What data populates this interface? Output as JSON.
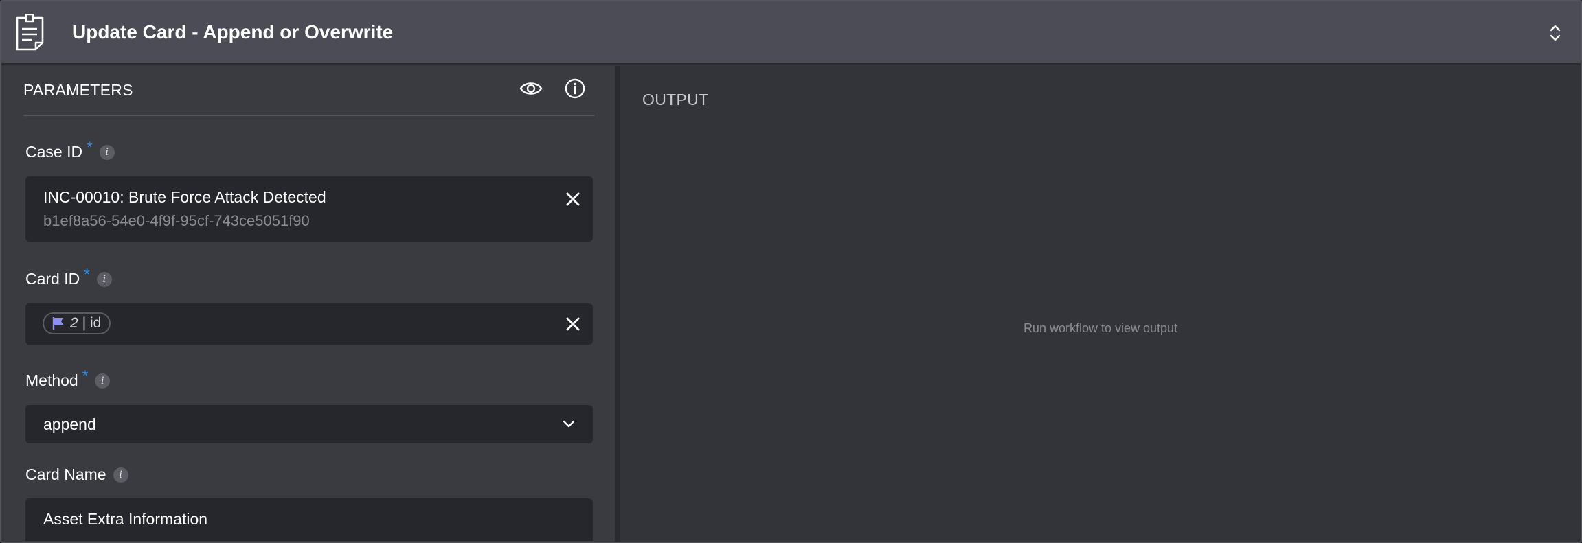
{
  "header": {
    "title": "Update Card - Append or Overwrite",
    "icon": "note-card-icon"
  },
  "parameters": {
    "title": "PARAMETERS",
    "fields": {
      "case_id": {
        "label": "Case ID",
        "required_mark": "*",
        "info_glyph": "i",
        "value_title": "INC-00010: Brute Force Attack Detected",
        "value_subtitle": "b1ef8a56-54e0-4f9f-95cf-743ce5051f90"
      },
      "card_id": {
        "label": "Card ID",
        "required_mark": "*",
        "info_glyph": "i",
        "chip_number": "2",
        "chip_text": "| id"
      },
      "method": {
        "label": "Method",
        "required_mark": "*",
        "info_glyph": "i",
        "selected": "append"
      },
      "card_name": {
        "label": "Card Name",
        "info_glyph": "i",
        "value": "Asset Extra Information"
      }
    }
  },
  "output": {
    "title": "OUTPUT",
    "empty_hint": "Run workflow to view output"
  },
  "colors": {
    "accent_required": "#2f8fe8",
    "header_bg": "#4b4c55",
    "field_bg": "#26272c",
    "flag_color": "#8e8ff0"
  }
}
